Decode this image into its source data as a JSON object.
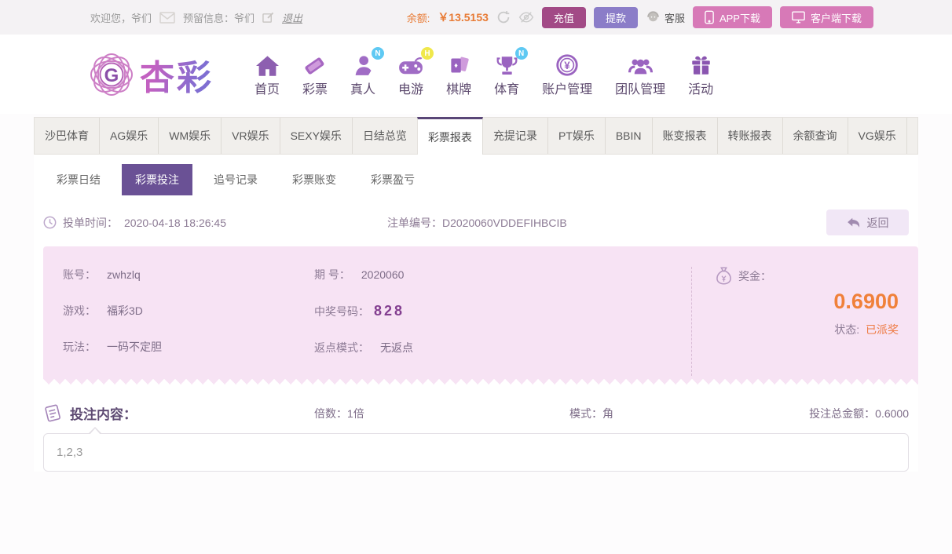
{
  "topbar": {
    "welcome": "欢迎您，爷们",
    "reserved": "预留信息：爷们",
    "logout": "退出",
    "balance_label": "余额:",
    "balance_value": "￥13.5153",
    "recharge": "充值",
    "withdraw": "提款",
    "service": "客服",
    "app_download": "APP下载",
    "client_download": "客户端下载"
  },
  "brand": {
    "name": "杏彩",
    "monogram": "G"
  },
  "nav": {
    "items": [
      {
        "label": "首页"
      },
      {
        "label": "彩票"
      },
      {
        "label": "真人",
        "badge": "N"
      },
      {
        "label": "电游",
        "badge": "H"
      },
      {
        "label": "棋牌"
      },
      {
        "label": "体育",
        "badge": "N"
      },
      {
        "label": "账户管理"
      },
      {
        "label": "团队管理"
      },
      {
        "label": "活动"
      }
    ]
  },
  "tabs": {
    "active": "彩票报表",
    "items": [
      "沙巴体育",
      "AG娱乐",
      "WM娱乐",
      "VR娱乐",
      "SEXY娱乐",
      "日结总览",
      "彩票报表",
      "充提记录",
      "PT娱乐",
      "BBIN",
      "账变报表",
      "转账报表",
      "余额查询",
      "VG娱乐"
    ]
  },
  "subtabs": {
    "active": "彩票投注",
    "items": [
      "彩票日结",
      "彩票投注",
      "追号记录",
      "彩票账变",
      "彩票盈亏"
    ]
  },
  "order": {
    "time_label": "投单时间：",
    "time": "2020-04-18 18:26:45",
    "no_label": "注单编号：",
    "no": "D2020060VDDEFIHBCIB",
    "back": "返回"
  },
  "detail": {
    "account_label": "账号：",
    "account": "zwhzlq",
    "game_label": "游戏：",
    "game": "福彩3D",
    "play_label": "玩法：",
    "play": "一码不定胆",
    "issue_label": "期 号：",
    "issue": "2020060",
    "win_no_label": "中奖号码：",
    "win_no": "828",
    "rebate_label": "返点模式：",
    "rebate": "无返点",
    "prize_label": "奖金：",
    "prize": "0.6900",
    "status_label": "状态:",
    "status": "已派奖"
  },
  "bet": {
    "content_label": "投注内容：",
    "multiple": "倍数：1倍",
    "mode": "模式：角",
    "total": "投注总金额：0.6000",
    "numbers": "1,2,3"
  },
  "colors": {
    "accent_purple": "#6a5195",
    "tab_active_border": "#594677",
    "panel_pink": "#f7e3f4",
    "orange": "#f0813a",
    "recharge_btn": "#a24a86",
    "withdraw_btn": "#8b7dc8",
    "download_btn": "#d779b7",
    "badge_n": "#5fc9f3",
    "badge_h": "#f0e84c"
  }
}
